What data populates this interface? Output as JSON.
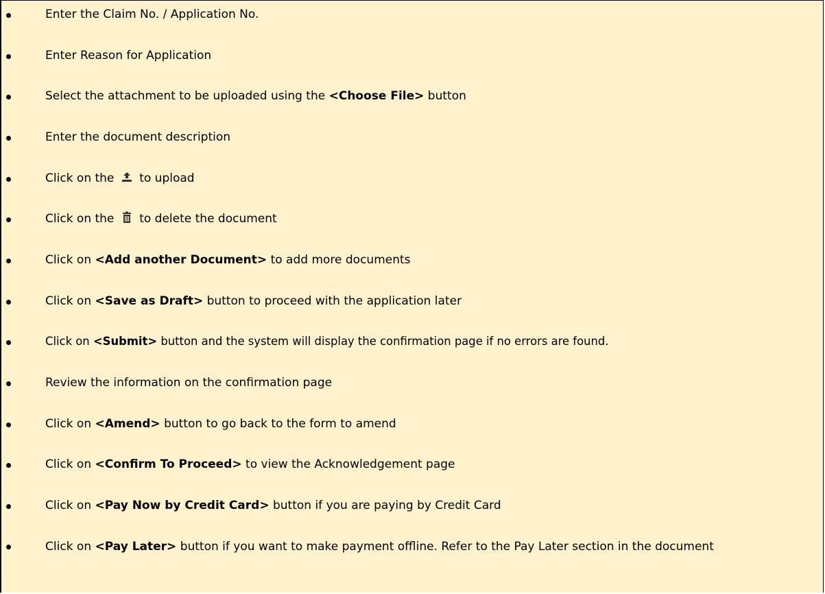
{
  "steps": [
    {
      "parts": [
        "Enter the Claim No. / Application No."
      ]
    },
    {
      "parts": [
        "Enter Reason for Application"
      ]
    },
    {
      "parts": [
        "Select the attachment to be uploaded using the ",
        "<Choose File>",
        " button"
      ]
    },
    {
      "parts": [
        "Enter the document description"
      ]
    },
    {
      "before": "Click on the ",
      "icon": "upload-icon",
      "after": " to upload"
    },
    {
      "before": "Click on the ",
      "icon": "trash-icon",
      "after": " to delete the document"
    },
    {
      "parts": [
        "Click on ",
        "<Add another Document>",
        " to add more documents"
      ]
    },
    {
      "parts": [
        "Click on ",
        "<Save as Draft>",
        " button to proceed with the application later"
      ]
    },
    {
      "parts": [
        "Click on ",
        "<Submit>",
        " button and the system will display the confirmation page if no errors are found."
      ]
    },
    {
      "parts": [
        "Review the information on the confirmation page"
      ]
    },
    {
      "parts": [
        "Click on ",
        "<Amend>",
        " button to go back to the form to amend"
      ]
    },
    {
      "parts": [
        "Click on ",
        "<Confirm To Proceed>",
        " to view the Acknowledgement page"
      ]
    },
    {
      "parts": [
        "Click on ",
        "<Pay Now by Credit Card>",
        " button if you are paying by Credit Card"
      ]
    },
    {
      "parts": [
        "Click on ",
        "<Pay Later>",
        " button if you want to make payment offline.  Refer to the Pay Later section in the document"
      ]
    }
  ],
  "colors": {
    "background": "#fff2cc",
    "border": "#000000",
    "icon": "#333333"
  }
}
